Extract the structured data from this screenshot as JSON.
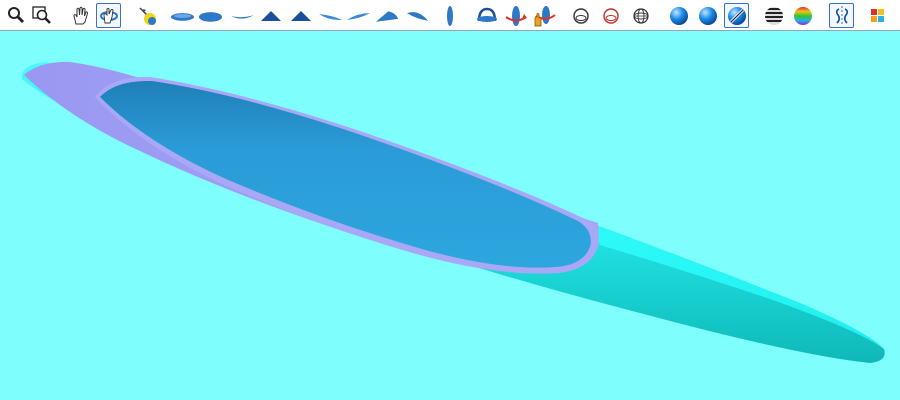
{
  "toolbar": {
    "colors": {
      "background": "#ffffff",
      "active_border": "#3c6fc8",
      "icon_blue": "#2e78c8",
      "arrow_red": "#e0302a",
      "hand_orange": "#f0a020"
    },
    "buttons": [
      {
        "icon": "zoom-icon",
        "active": false
      },
      {
        "icon": "zoom-window-icon",
        "active": false
      },
      {
        "icon": "pan-hand-icon",
        "active": false
      },
      {
        "icon": "rotate-view-icon",
        "active": true
      },
      {
        "icon": "light-source-icon",
        "active": false
      },
      {
        "icon": "view-top-icon",
        "active": false
      },
      {
        "icon": "view-bottom-icon",
        "active": false
      },
      {
        "icon": "view-side-icon",
        "active": false
      },
      {
        "icon": "view-front-icon",
        "active": false
      },
      {
        "icon": "view-back-icon",
        "active": false
      },
      {
        "icon": "view-left-icon",
        "active": false
      },
      {
        "icon": "view-right-icon",
        "active": false
      },
      {
        "icon": "view-iso-icon",
        "active": false
      },
      {
        "icon": "view-iso-2-icon",
        "active": false
      },
      {
        "icon": "view-end-icon",
        "active": false
      },
      {
        "icon": "rotate-x-icon",
        "active": false
      },
      {
        "icon": "rotate-y-icon",
        "active": false
      },
      {
        "icon": "rotate-hand-icon",
        "active": false
      },
      {
        "icon": "render-outline-icon",
        "active": false
      },
      {
        "icon": "render-hidden-line-icon",
        "active": false
      },
      {
        "icon": "render-wireframe-icon",
        "active": false
      },
      {
        "icon": "render-shaded-icon",
        "active": false
      },
      {
        "icon": "render-smooth-icon",
        "active": false
      },
      {
        "icon": "render-edit-shaded-icon",
        "active": true
      },
      {
        "icon": "render-stripes-icon",
        "active": false
      },
      {
        "icon": "render-curvature-icon",
        "active": false
      },
      {
        "icon": "symmetry-icon",
        "active": true
      },
      {
        "icon": "color-palette-icon",
        "active": false
      }
    ]
  },
  "viewport": {
    "background": "#7ffefe",
    "hull_color": "#22e6e6",
    "hull_shadow": "#0fb8b8",
    "deck_color": "#9a9cf2",
    "cockpit_color": "#2a9bd6",
    "cockpit_shadow": "#1f7fb8"
  }
}
